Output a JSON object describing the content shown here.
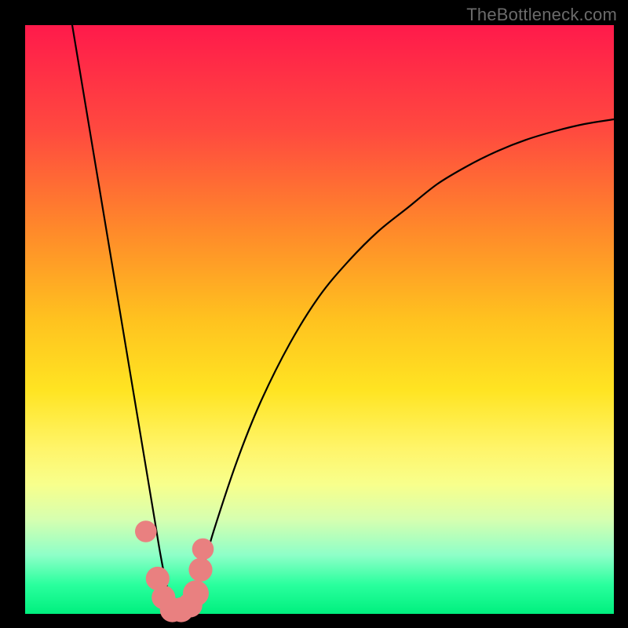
{
  "watermark": "TheBottleneck.com",
  "chart_data": {
    "type": "line",
    "title": "",
    "xlabel": "",
    "ylabel": "",
    "xlim": [
      0,
      100
    ],
    "ylim": [
      0,
      100
    ],
    "series": [
      {
        "name": "curve",
        "x": [
          8,
          10,
          12,
          14,
          16,
          18,
          20,
          21,
          22,
          23,
          24,
          25,
          26,
          27,
          28,
          30,
          32,
          36,
          40,
          45,
          50,
          55,
          60,
          65,
          70,
          75,
          80,
          85,
          90,
          95,
          100
        ],
        "y": [
          100,
          88,
          76,
          64,
          52,
          40,
          28,
          22,
          16,
          10,
          5,
          2,
          0.5,
          0.5,
          2,
          7,
          14,
          26,
          36,
          46,
          54,
          60,
          65,
          69,
          73,
          76,
          78.5,
          80.5,
          82,
          83.2,
          84
        ]
      }
    ],
    "markers": [
      {
        "x": 20.5,
        "y": 14,
        "r": 1.3
      },
      {
        "x": 22.5,
        "y": 6,
        "r": 1.5
      },
      {
        "x": 23.5,
        "y": 2.8,
        "r": 1.5
      },
      {
        "x": 25.0,
        "y": 0.7,
        "r": 1.6
      },
      {
        "x": 26.5,
        "y": 0.7,
        "r": 1.6
      },
      {
        "x": 28.0,
        "y": 1.5,
        "r": 1.6
      },
      {
        "x": 29.0,
        "y": 3.5,
        "r": 1.7
      },
      {
        "x": 29.8,
        "y": 7.5,
        "r": 1.5
      },
      {
        "x": 30.2,
        "y": 11,
        "r": 1.3
      }
    ],
    "gradient_stops": [
      {
        "pos": 0,
        "color": "#ff1a4b"
      },
      {
        "pos": 18,
        "color": "#ff4a3f"
      },
      {
        "pos": 35,
        "color": "#ff8a2a"
      },
      {
        "pos": 50,
        "color": "#ffc21f"
      },
      {
        "pos": 62,
        "color": "#ffe422"
      },
      {
        "pos": 72,
        "color": "#fff56a"
      },
      {
        "pos": 78,
        "color": "#f8ff8c"
      },
      {
        "pos": 84,
        "color": "#d6ffb0"
      },
      {
        "pos": 90,
        "color": "#8effc8"
      },
      {
        "pos": 95,
        "color": "#2aff9e"
      },
      {
        "pos": 100,
        "color": "#00f07e"
      }
    ]
  }
}
